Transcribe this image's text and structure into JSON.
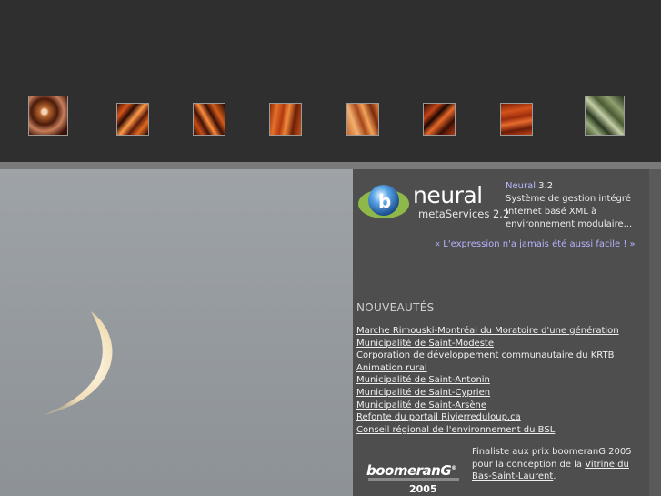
{
  "thumbnails": [
    {
      "name": "Thumbnail 1"
    },
    {
      "name": "Thumbnail 2"
    },
    {
      "name": "Thumbnail 3"
    },
    {
      "name": "Thumbnail 4"
    },
    {
      "name": "Thumbnail 5"
    },
    {
      "name": "Thumbnail 6"
    },
    {
      "name": "Thumbnail 7"
    },
    {
      "name": "Thumbnail 8"
    }
  ],
  "logo": {
    "word": "neural",
    "sub": "metaServices 2.2"
  },
  "description": {
    "name": "Neural",
    "version": " 3.2",
    "text": "Système de gestion intégré Internet basé XML à environnement modulaire..."
  },
  "tagline": "« L'expression n'a jamais été aussi facile ! »",
  "news": {
    "title": "NOUVEAUTÉS",
    "items": [
      "Marche Rimouski-Montréal du Moratoire d'une génération",
      "Municipalité de Saint-Modeste",
      "Corporation de développement communautaire du KRTB",
      "Animation rural",
      "Municipalité de Saint-Antonin",
      "Municipalité de Saint-Cyprien",
      "Municipalité de Saint-Arsène",
      "Refonte du portail Rivierreduloup.ca",
      "Conseil régional de l'environnement du BSL"
    ]
  },
  "award": {
    "logo": "boomeranG",
    "year": "2005",
    "text_before": "Finaliste aux prix boomeranG 2005 pour la conception de la ",
    "link": "Vitrine du Bas-Saint-Laurent",
    "text_after": "."
  },
  "colors": {
    "link": "#b4b4ff",
    "panel": "#4e4e4e",
    "topbar": "#2f2f30"
  }
}
